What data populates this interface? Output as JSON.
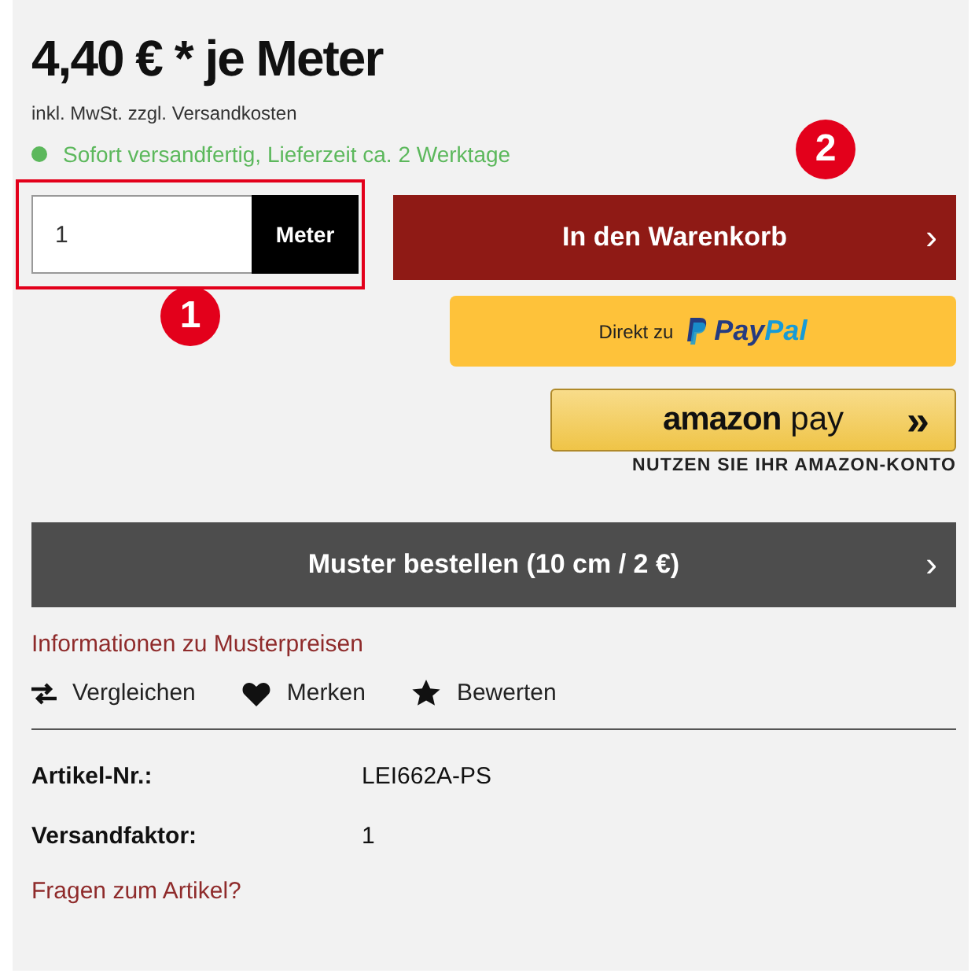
{
  "price": "4,40 € * je Meter",
  "tax_note": "inkl. MwSt. zzgl. Versandkosten",
  "availability": {
    "text": "Sofort versandfertig, Lieferzeit ca. 2 Werktage",
    "color": "#5cb85c"
  },
  "quantity": {
    "value": "1",
    "unit": "Meter"
  },
  "cart_button": {
    "label": "In den Warenkorb",
    "chevron": "›"
  },
  "callouts": [
    {
      "label": "1"
    },
    {
      "label": "2"
    }
  ],
  "paypal_button": {
    "prefix": "Direkt zu",
    "pay": "Pay",
    "pal": "Pal"
  },
  "amazon_button": {
    "logo": "amazon",
    "pay": "pay",
    "chevrons": "»",
    "caption": "NUTZEN SIE IHR AMAZON-KONTO"
  },
  "sample_button": {
    "label": "Muster bestellen (10 cm / 2 €)",
    "chevron": "›"
  },
  "sample_info_link": "Informationen zu Musterpreisen",
  "actions": [
    {
      "kind": "compare",
      "label": "Vergleichen"
    },
    {
      "kind": "wishlist",
      "label": "Merken"
    },
    {
      "kind": "rate",
      "label": "Bewerten"
    }
  ],
  "details": [
    {
      "label": "Artikel-Nr.:",
      "value": "LEI662A-PS"
    },
    {
      "label": "Versandfaktor:",
      "value": "1"
    }
  ],
  "question_link": "Fragen zum Artikel?"
}
